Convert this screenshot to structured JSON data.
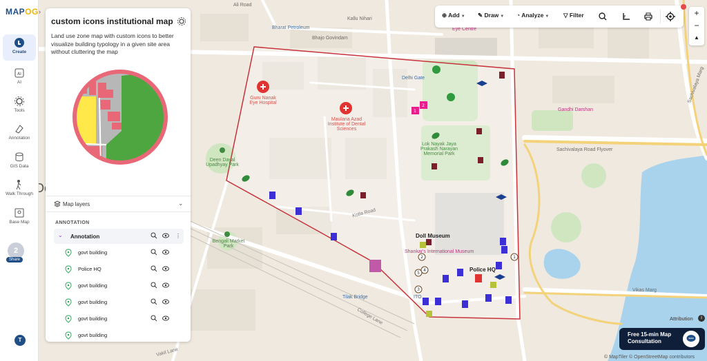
{
  "app": {
    "logo_prefix": "MAP",
    "logo_suffix": "OG"
  },
  "rail": {
    "items": [
      {
        "label": "Create",
        "icon": "create-icon"
      },
      {
        "label": "AI",
        "icon": "ai-icon"
      },
      {
        "label": "Tools",
        "icon": "tools-icon"
      },
      {
        "label": "Annotation",
        "icon": "annotation-icon"
      },
      {
        "label": "GIS Data",
        "icon": "gis-data-icon"
      },
      {
        "label": "Walk Through",
        "icon": "walk-through-icon"
      },
      {
        "label": "Base Map",
        "icon": "base-map-icon"
      }
    ],
    "share_count": "2",
    "share_label": "Share",
    "avatar_initial": "T"
  },
  "panel": {
    "title": "custom icons institutional map",
    "description": "Land use zone map with custom icons to better visualize building typology in a given site area without cluttering the map",
    "layers_label": "Map layers",
    "section_label": "ANNOTATION",
    "group_label": "Annotation",
    "layers": [
      "govt building",
      "Police HQ",
      "govt building",
      "govt building",
      "govt building",
      "govt building"
    ]
  },
  "toolbar": {
    "add": "Add",
    "draw": "Draw",
    "analyze": "Analyze",
    "filter": "Filter"
  },
  "zoom": {
    "in": "+",
    "out": "−",
    "compass": "▲"
  },
  "consult": {
    "label": "Free 15-min Map Consultation"
  },
  "attribution": "Attribution",
  "copyright": "© MapTiler © OpenStreetMap contributors",
  "map_labels": {
    "ali_road": "Ali Road",
    "bharat_petroleum": "Bharat Petroleum",
    "kallu_nihari": "Kallu Nihari",
    "bhajo_govindam": "Bhajo Govindam",
    "eye_centre": "Eye Centre",
    "delhi_gate": "Delhi Gate",
    "guru_nanak": "Guru Nanak Eye Hospital",
    "maulana_azad": "Maulana Azad Institute of Dental Sciences",
    "gandhi_darshan": "Gandhi Darshan",
    "lok_nayak": "Lok Nayak Jaya Prakash Narayan Memorial Park",
    "deen_dayal": "Deen Dayal Upadhyay Park",
    "sachivalaya": "Sachivalaya Road Flyover",
    "kotla_road": "Kotla Road",
    "bengali_market": "Bengali Market Park",
    "doll_museum": "Doll Museum",
    "shankar_intl": "Shankar's International Museum",
    "police_hq": "Police HQ",
    "tilak_bridge": "Tilak Bridge",
    "college_lane": "College Lane",
    "vikas_marg": "Vikas Marg",
    "sachivalaya_marg": "Sachivalaya Marg",
    "vakil_lane": "Vakil Lane",
    "ito": "ITO",
    "de": "De"
  },
  "colors": {
    "brand": "#1f4f86",
    "boundary": "#c8333b",
    "building_icon": "#3c2fd6",
    "hospital": "#e23333",
    "park": "#2f9a3e",
    "water": "#a9d3ec"
  }
}
